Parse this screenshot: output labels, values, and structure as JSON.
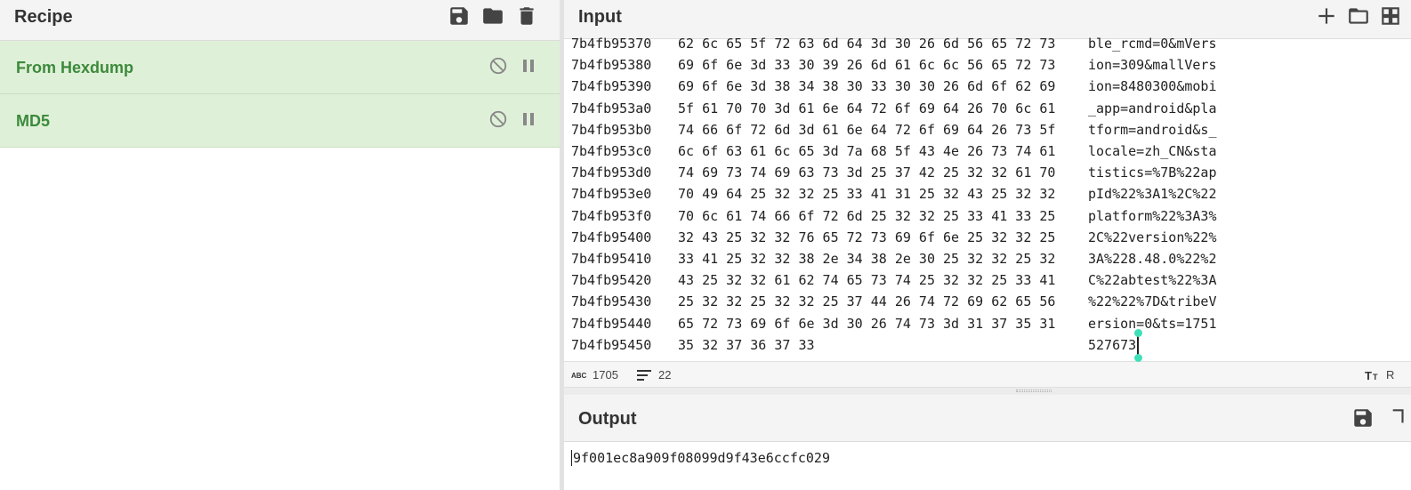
{
  "recipe": {
    "title": "Recipe",
    "icons": [
      "save-icon",
      "folder-icon",
      "trash-icon"
    ],
    "operations": [
      {
        "name": "From Hexdump",
        "color": "#3c8a3c"
      },
      {
        "name": "MD5",
        "color": "#3c8a3c"
      }
    ]
  },
  "input": {
    "title": "Input",
    "icons": [
      "plus-icon",
      "folder-icon",
      "layout-icon"
    ],
    "rows": [
      {
        "addr": "7b4fb95370",
        "bytes": "62 6c 65 5f 72 63 6d 64 3d 30 26 6d 56 65 72 73",
        "ascii": "ble_rcmd=0&mVers"
      },
      {
        "addr": "7b4fb95380",
        "bytes": "69 6f 6e 3d 33 30 39 26 6d 61 6c 6c 56 65 72 73",
        "ascii": "ion=309&mallVers"
      },
      {
        "addr": "7b4fb95390",
        "bytes": "69 6f 6e 3d 38 34 38 30 33 30 30 26 6d 6f 62 69",
        "ascii": "ion=8480300&mobi"
      },
      {
        "addr": "7b4fb953a0",
        "bytes": "5f 61 70 70 3d 61 6e 64 72 6f 69 64 26 70 6c 61",
        "ascii": "_app=android&pla"
      },
      {
        "addr": "7b4fb953b0",
        "bytes": "74 66 6f 72 6d 3d 61 6e 64 72 6f 69 64 26 73 5f",
        "ascii": "tform=android&s_"
      },
      {
        "addr": "7b4fb953c0",
        "bytes": "6c 6f 63 61 6c 65 3d 7a 68 5f 43 4e 26 73 74 61",
        "ascii": "locale=zh_CN&sta"
      },
      {
        "addr": "7b4fb953d0",
        "bytes": "74 69 73 74 69 63 73 3d 25 37 42 25 32 32 61 70",
        "ascii": "tistics=%7B%22ap"
      },
      {
        "addr": "7b4fb953e0",
        "bytes": "70 49 64 25 32 32 25 33 41 31 25 32 43 25 32 32",
        "ascii": "pId%22%3A1%2C%22"
      },
      {
        "addr": "7b4fb953f0",
        "bytes": "70 6c 61 74 66 6f 72 6d 25 32 32 25 33 41 33 25",
        "ascii": "platform%22%3A3%"
      },
      {
        "addr": "7b4fb95400",
        "bytes": "32 43 25 32 32 76 65 72 73 69 6f 6e 25 32 32 25",
        "ascii": "2C%22version%22%"
      },
      {
        "addr": "7b4fb95410",
        "bytes": "33 41 25 32 32 38 2e 34 38 2e 30 25 32 32 25 32",
        "ascii": "3A%228.48.0%22%2"
      },
      {
        "addr": "7b4fb95420",
        "bytes": "43 25 32 32 61 62 74 65 73 74 25 32 32 25 33 41",
        "ascii": "C%22abtest%22%3A"
      },
      {
        "addr": "7b4fb95430",
        "bytes": "25 32 32 25 32 32 25 37 44 26 74 72 69 62 65 56",
        "ascii": "%22%22%7D&tribeV"
      },
      {
        "addr": "7b4fb95440",
        "bytes": "65 72 73 69 6f 6e 3d 30 26 74 73 3d 31 37 35 31",
        "ascii": "ersion=0&ts=1751"
      },
      {
        "addr": "7b4fb95450",
        "bytes": "35 32 37 36 37 33",
        "ascii": "527673"
      }
    ],
    "status": {
      "char_count": "1705",
      "line_count": "22",
      "right_label": "R"
    }
  },
  "output": {
    "title": "Output",
    "value": "9f001ec8a909f08099d9f43e6ccfc029"
  }
}
